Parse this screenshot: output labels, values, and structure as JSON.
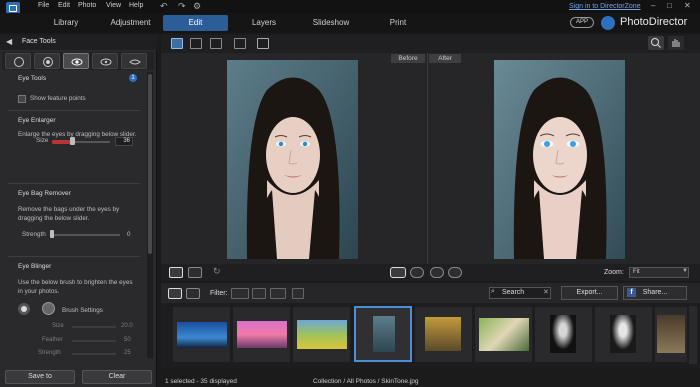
{
  "menu": {
    "items": [
      "File",
      "Edit",
      "Photo",
      "View",
      "Help"
    ],
    "director_zone_link": "Sign in to DirectorZone",
    "app_badge": "APP",
    "product_name": "PhotoDirector"
  },
  "modules": {
    "tabs": [
      "Library",
      "Adjustment",
      "Edit",
      "Layers",
      "Slideshow",
      "Print"
    ],
    "active": "Edit"
  },
  "left_panel": {
    "title": "Face Tools",
    "eye_tools_label": "Eye Tools",
    "info_badge": "1",
    "show_feature_points": "Show feature points",
    "eye_enlarger": {
      "title": "Eye Enlarger",
      "description": "Enlarge the eyes by dragging below slider.",
      "size_label": "Size",
      "size_value": "36",
      "size_fraction": 0.36
    },
    "eye_bag_remover": {
      "title": "Eye Bag Remover",
      "description": "Remove the bags under the eyes by dragging the below slider.",
      "strength_label": "Strength",
      "strength_value": "0"
    },
    "eye_blinger": {
      "title": "Eye Blinger",
      "description": "Use the below brush to brighten the eyes in your photos.",
      "brush_settings": "Brush Settings",
      "size_label": "Size",
      "size_value": "20.0",
      "feather_label": "Feather",
      "feather_value": "50",
      "strength_label": "Strength",
      "strength_value": "25"
    },
    "save_to": "Save to",
    "clear": "Clear"
  },
  "viewer": {
    "before_label": "Before",
    "after_label": "After"
  },
  "controls": {
    "zoom_label": "Zoom:",
    "zoom_value": "Fit"
  },
  "film_toolbar": {
    "filter_label": "Filter:",
    "search_placeholder": "Search",
    "export_label": "Export...",
    "share_label": "Share..."
  },
  "status": {
    "count": "1 selected - 35 displayed",
    "path": "Collection / All Photos / SkinTone.jpg"
  },
  "colors": {
    "accent": "#2b5e96",
    "selection": "#4d8fd6",
    "panel_bg": "#2a2a2c"
  }
}
